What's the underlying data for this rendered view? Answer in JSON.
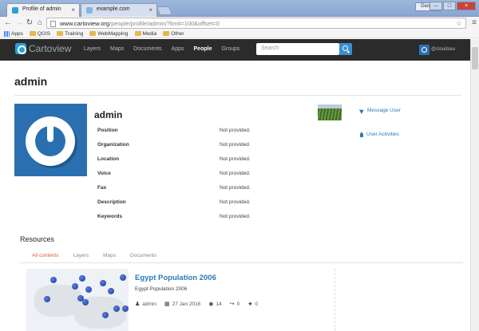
{
  "browser": {
    "tabs": [
      {
        "title": "Profile of admin",
        "active": true
      },
      {
        "title": "example.com",
        "active": false
      }
    ],
    "user_chip": "George",
    "url_host": "www.cartoview.org",
    "url_path": "/people/profile/admin/?limit=100&offset=0",
    "bookmarks": [
      "Apps",
      "QGIS",
      "Training",
      "WebMapping",
      "Media",
      "Other"
    ]
  },
  "site": {
    "logo_text": "Cartoview",
    "nav": [
      "Layers",
      "Maps",
      "Documents",
      "Apps",
      "People",
      "Groups"
    ],
    "active_nav": "People",
    "search_placeholder": "Search",
    "user": "@cloudseu"
  },
  "profile": {
    "page_title": "admin",
    "name": "admin",
    "fields": [
      {
        "label": "Position",
        "value": "Not provided."
      },
      {
        "label": "Organization",
        "value": "Not provided."
      },
      {
        "label": "Location",
        "value": "Not provided."
      },
      {
        "label": "Voice",
        "value": "Not provided."
      },
      {
        "label": "Fax",
        "value": "Not provided."
      },
      {
        "label": "Description",
        "value": "Not provided."
      },
      {
        "label": "Keywords",
        "value": "Not provided."
      }
    ],
    "actions": [
      "Message User",
      "User Activities"
    ]
  },
  "resources": {
    "title": "Resources",
    "tabs": [
      "All contents",
      "Layers",
      "Maps",
      "Documents"
    ],
    "active_tab": "All contents",
    "items": [
      {
        "name": "Egypt Population 2006",
        "subtitle": "Egypt Population 2006",
        "owner": "admin",
        "date": "27 Jan 2016",
        "views": "14",
        "shares": "0",
        "rating": "0"
      }
    ]
  },
  "colors": {
    "brand": "#2a9fd8",
    "link": "#2a7ab8",
    "active_tab": "#e05a3a",
    "navbar": "#2b2b2b"
  }
}
